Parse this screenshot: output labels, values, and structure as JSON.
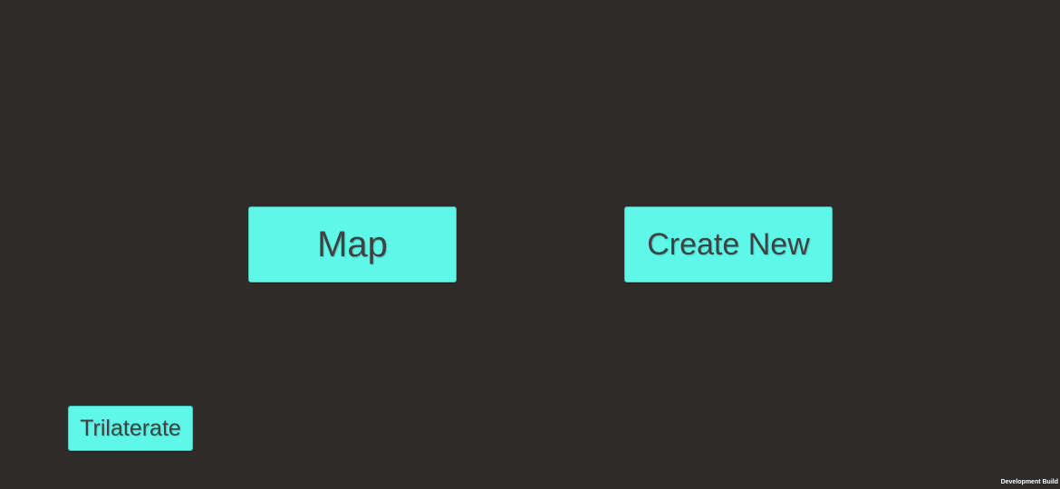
{
  "buttons": {
    "map_label": "Map",
    "create_new_label": "Create New",
    "trilaterate_label": "Trilaterate"
  },
  "footer": {
    "build_label": "Development Build"
  },
  "colors": {
    "background": "#2d2c2b",
    "button_fill": "#5ff7e8",
    "button_text": "#3f4242"
  }
}
